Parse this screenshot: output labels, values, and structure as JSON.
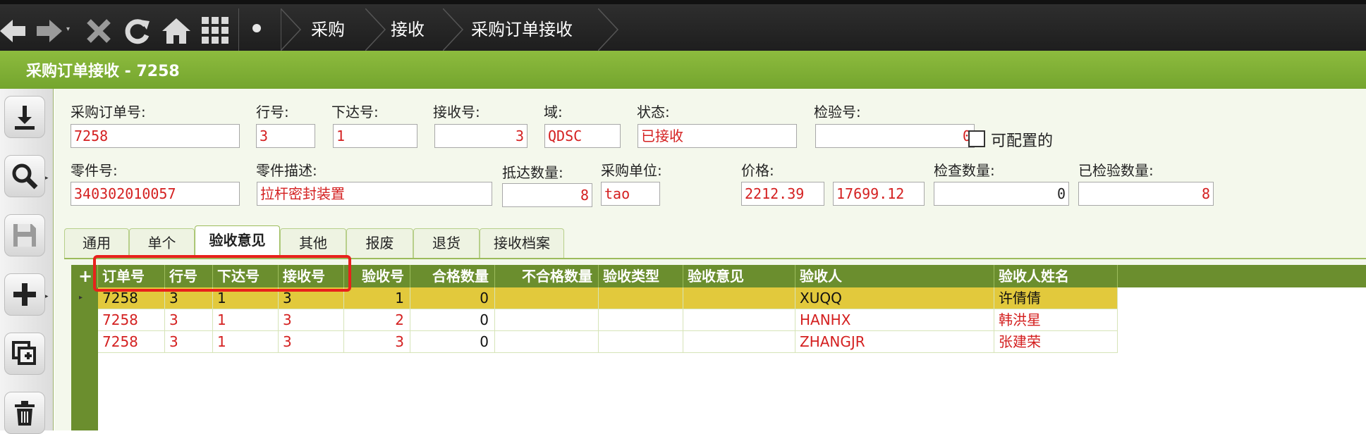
{
  "nav": {
    "breadcrumbs": [
      "采购",
      "接收",
      "采购订单接收"
    ]
  },
  "title": "采购订单接收 - 7258",
  "form": {
    "po_label": "采购订单号:",
    "po_value": "7258",
    "line_label": "行号:",
    "line_value": "3",
    "release_label": "下达号:",
    "release_value": "1",
    "receipt_label": "接收号:",
    "receipt_value": "3",
    "domain_label": "域:",
    "domain_value": "QDSC",
    "status_label": "状态:",
    "status_value": "已接收",
    "inspect_label": "检验号:",
    "inspect_value": "0",
    "configurable_label": "可配置的",
    "part_label": "零件号:",
    "part_value": "340302010057",
    "desc_label": "零件描述:",
    "desc_value": "拉杆密封装置",
    "arrival_label": "抵达数量:",
    "arrival_value": "8",
    "unit_label": "采购单位:",
    "unit_value": "tao",
    "price_label": "价格:",
    "price_value1": "2212.39",
    "price_value2": "17699.12",
    "checkqty_label": "检查数量:",
    "checkqty_value": "0",
    "inspected_label": "已检验数量:",
    "inspected_value": "8"
  },
  "tabs": [
    "通用",
    "单个",
    "验收意见",
    "其他",
    "报废",
    "退货",
    "接收档案"
  ],
  "active_tab": "验收意见",
  "grid": {
    "add": "+",
    "columns": [
      "订单号",
      "行号",
      "下达号",
      "接收号",
      "验收号",
      "合格数量",
      "不合格数量",
      "验收类型",
      "验收意见",
      "验收人",
      "验收人姓名"
    ],
    "rows": [
      [
        "7258",
        "3",
        "1",
        "3",
        "1",
        "0",
        "",
        "",
        "",
        "XUQQ",
        "许倩倩"
      ],
      [
        "7258",
        "3",
        "1",
        "3",
        "2",
        "0",
        "",
        "",
        "",
        "HANHX",
        "韩洪星"
      ],
      [
        "7258",
        "3",
        "1",
        "3",
        "3",
        "0",
        "",
        "",
        "",
        "ZHANGJR",
        "张建荣"
      ]
    ]
  },
  "colors": {
    "accent_green": "#74a52e",
    "header_green": "#6b8e2e",
    "selected_row": "#e2c93c",
    "value_red": "#d42020",
    "highlight_red": "#e8211c"
  },
  "icons": {
    "top": [
      "back-arrow-icon",
      "forward-arrow-icon",
      "close-icon",
      "refresh-icon",
      "home-icon",
      "grid-menu-icon",
      "dot-icon"
    ],
    "left": [
      "download-icon",
      "search-icon",
      "save-icon",
      "add-icon",
      "copy-add-icon",
      "delete-icon"
    ]
  }
}
